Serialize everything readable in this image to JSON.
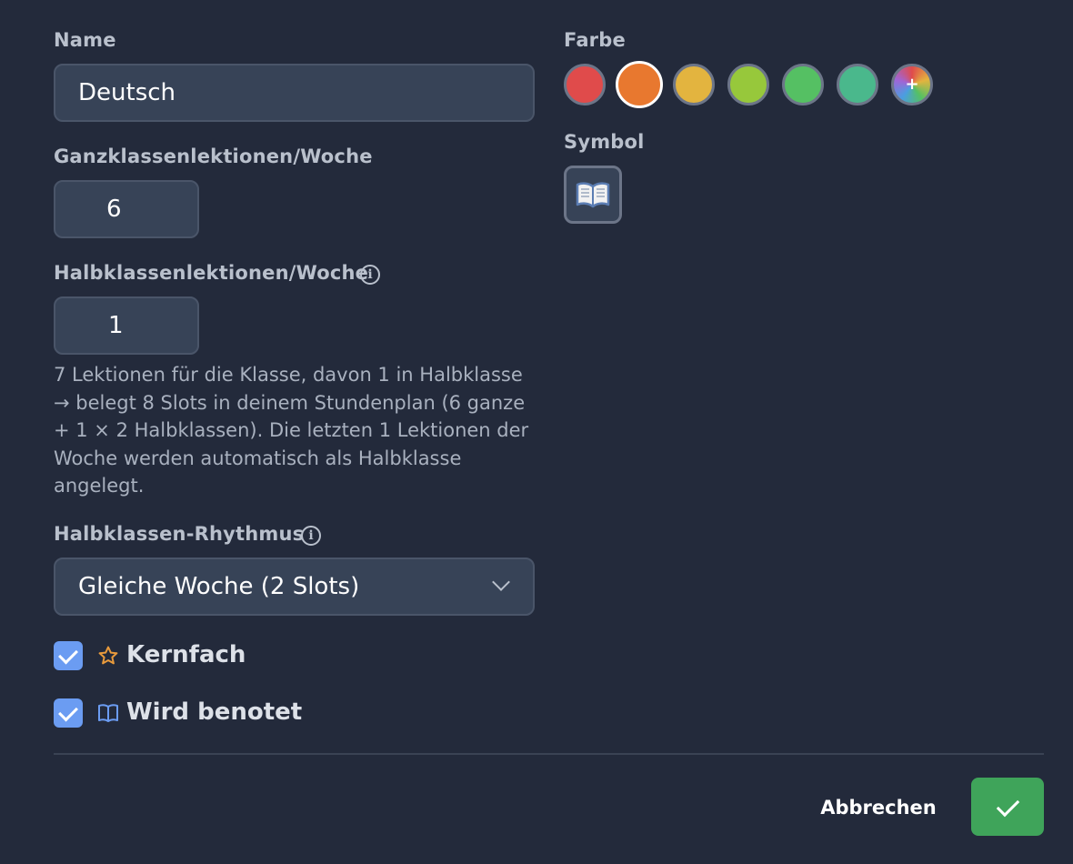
{
  "form": {
    "name_label": "Name",
    "name_value": "Deutsch",
    "ganz_label": "Ganzklassenlektionen/Woche",
    "ganz_value": "6",
    "halb_label": "Halbklassenlektionen/Woche",
    "halb_value": "1",
    "help_text": "7 Lektionen für die Klasse, davon 1 in Halbklasse → belegt 8 Slots in deinem Stundenplan (6 ganze + 1 × 2 Halbklassen). Die letzten 1 Lektionen der Woche werden automatisch als Halbklasse angelegt.",
    "rhythm_label": "Halbklassen-Rhythmus",
    "rhythm_value": "Gleiche Woche (2 Slots)",
    "kernfach_label": "Kernfach",
    "kernfach_checked": true,
    "benotet_label": "Wird benotet",
    "benotet_checked": true
  },
  "color": {
    "label": "Farbe",
    "swatches": [
      {
        "name": "red",
        "hex": "#e04b4b"
      },
      {
        "name": "orange",
        "hex": "#e8782f",
        "selected": true
      },
      {
        "name": "yellow",
        "hex": "#e3b43f"
      },
      {
        "name": "lime",
        "hex": "#97c83b"
      },
      {
        "name": "green",
        "hex": "#55c063"
      },
      {
        "name": "teal",
        "hex": "#4ab88c"
      },
      {
        "name": "custom",
        "hex": "rainbow",
        "icon": "plus-icon"
      }
    ]
  },
  "symbol": {
    "label": "Symbol",
    "icon": "open-book-icon",
    "glyph": "📖"
  },
  "footer": {
    "cancel_label": "Abbrechen",
    "confirm_icon": "check-icon"
  },
  "colors": {
    "background": "#232a3b",
    "input_bg": "#374357",
    "checkbox": "#6b9cf2",
    "confirm": "#3fa45a",
    "star": "#e89a3c",
    "book_icon": "#6b9cf2"
  }
}
